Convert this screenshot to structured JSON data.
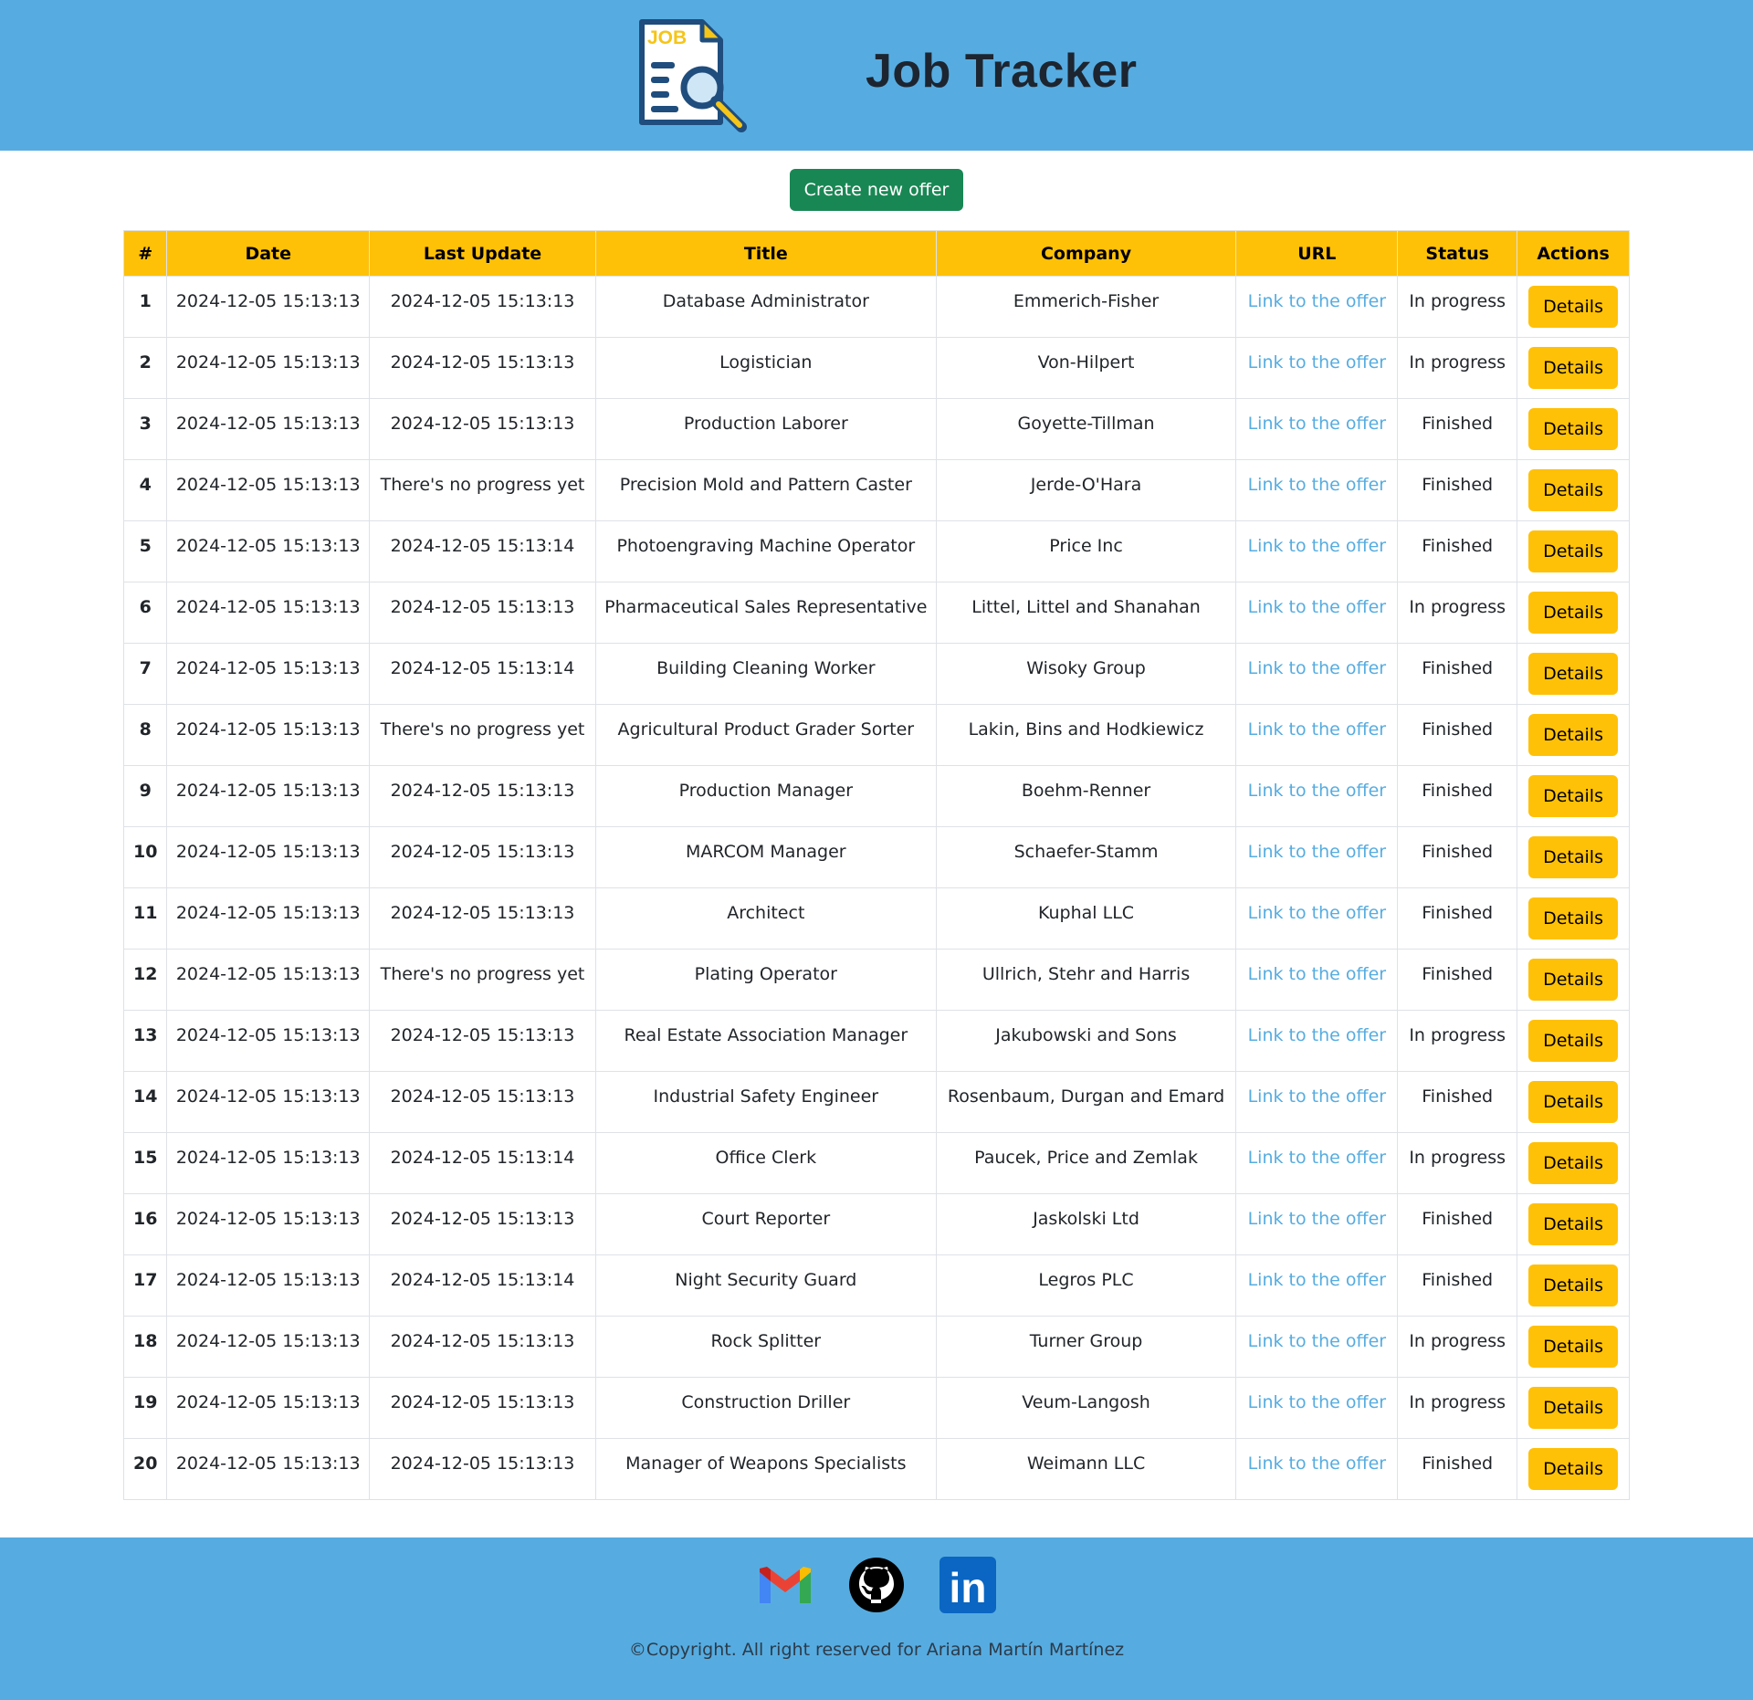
{
  "header": {
    "logo_text": "JOB",
    "title": "Job Tracker"
  },
  "actions": {
    "create_label": "Create new offer"
  },
  "table": {
    "columns": [
      "#",
      "Date",
      "Last Update",
      "Title",
      "Company",
      "URL",
      "Status",
      "Actions"
    ],
    "link_label": "Link to the offer",
    "details_label": "Details",
    "rows": [
      {
        "num": "1",
        "date": "2024-12-05 15:13:13",
        "update": "2024-12-05 15:13:13",
        "title": "Database Administrator",
        "company": "Emmerich-Fisher",
        "status": "In progress"
      },
      {
        "num": "2",
        "date": "2024-12-05 15:13:13",
        "update": "2024-12-05 15:13:13",
        "title": "Logistician",
        "company": "Von-Hilpert",
        "status": "In progress"
      },
      {
        "num": "3",
        "date": "2024-12-05 15:13:13",
        "update": "2024-12-05 15:13:13",
        "title": "Production Laborer",
        "company": "Goyette-Tillman",
        "status": "Finished"
      },
      {
        "num": "4",
        "date": "2024-12-05 15:13:13",
        "update": "There's no progress yet",
        "title": "Precision Mold and Pattern Caster",
        "company": "Jerde-O'Hara",
        "status": "Finished"
      },
      {
        "num": "5",
        "date": "2024-12-05 15:13:13",
        "update": "2024-12-05 15:13:14",
        "title": "Photoengraving Machine Operator",
        "company": "Price Inc",
        "status": "Finished"
      },
      {
        "num": "6",
        "date": "2024-12-05 15:13:13",
        "update": "2024-12-05 15:13:13",
        "title": "Pharmaceutical Sales Representative",
        "company": "Littel, Littel and Shanahan",
        "status": "In progress"
      },
      {
        "num": "7",
        "date": "2024-12-05 15:13:13",
        "update": "2024-12-05 15:13:14",
        "title": "Building Cleaning Worker",
        "company": "Wisoky Group",
        "status": "Finished"
      },
      {
        "num": "8",
        "date": "2024-12-05 15:13:13",
        "update": "There's no progress yet",
        "title": "Agricultural Product Grader Sorter",
        "company": "Lakin, Bins and Hodkiewicz",
        "status": "Finished"
      },
      {
        "num": "9",
        "date": "2024-12-05 15:13:13",
        "update": "2024-12-05 15:13:13",
        "title": "Production Manager",
        "company": "Boehm-Renner",
        "status": "Finished"
      },
      {
        "num": "10",
        "date": "2024-12-05 15:13:13",
        "update": "2024-12-05 15:13:13",
        "title": "MARCOM Manager",
        "company": "Schaefer-Stamm",
        "status": "Finished"
      },
      {
        "num": "11",
        "date": "2024-12-05 15:13:13",
        "update": "2024-12-05 15:13:13",
        "title": "Architect",
        "company": "Kuphal LLC",
        "status": "Finished"
      },
      {
        "num": "12",
        "date": "2024-12-05 15:13:13",
        "update": "There's no progress yet",
        "title": "Plating Operator",
        "company": "Ullrich, Stehr and Harris",
        "status": "Finished"
      },
      {
        "num": "13",
        "date": "2024-12-05 15:13:13",
        "update": "2024-12-05 15:13:13",
        "title": "Real Estate Association Manager",
        "company": "Jakubowski and Sons",
        "status": "In progress"
      },
      {
        "num": "14",
        "date": "2024-12-05 15:13:13",
        "update": "2024-12-05 15:13:13",
        "title": "Industrial Safety Engineer",
        "company": "Rosenbaum, Durgan and Emard",
        "status": "Finished"
      },
      {
        "num": "15",
        "date": "2024-12-05 15:13:13",
        "update": "2024-12-05 15:13:14",
        "title": "Office Clerk",
        "company": "Paucek, Price and Zemlak",
        "status": "In progress"
      },
      {
        "num": "16",
        "date": "2024-12-05 15:13:13",
        "update": "2024-12-05 15:13:13",
        "title": "Court Reporter",
        "company": "Jaskolski Ltd",
        "status": "Finished"
      },
      {
        "num": "17",
        "date": "2024-12-05 15:13:13",
        "update": "2024-12-05 15:13:14",
        "title": "Night Security Guard",
        "company": "Legros PLC",
        "status": "Finished"
      },
      {
        "num": "18",
        "date": "2024-12-05 15:13:13",
        "update": "2024-12-05 15:13:13",
        "title": "Rock Splitter",
        "company": "Turner Group",
        "status": "In progress"
      },
      {
        "num": "19",
        "date": "2024-12-05 15:13:13",
        "update": "2024-12-05 15:13:13",
        "title": "Construction Driller",
        "company": "Veum-Langosh",
        "status": "In progress"
      },
      {
        "num": "20",
        "date": "2024-12-05 15:13:13",
        "update": "2024-12-05 15:13:13",
        "title": "Manager of Weapons Specialists",
        "company": "Weimann LLC",
        "status": "Finished"
      }
    ]
  },
  "footer": {
    "icons": [
      "gmail-icon",
      "github-icon",
      "linkedin-icon"
    ],
    "linkedin_text": "in",
    "copyright": "©Copyright. All right reserved for Ariana Martín Martínez"
  },
  "colors": {
    "header_bg": "#56ace0",
    "accent_yellow": "#ffc107",
    "create_green": "#198754",
    "link": "#56ace0"
  }
}
